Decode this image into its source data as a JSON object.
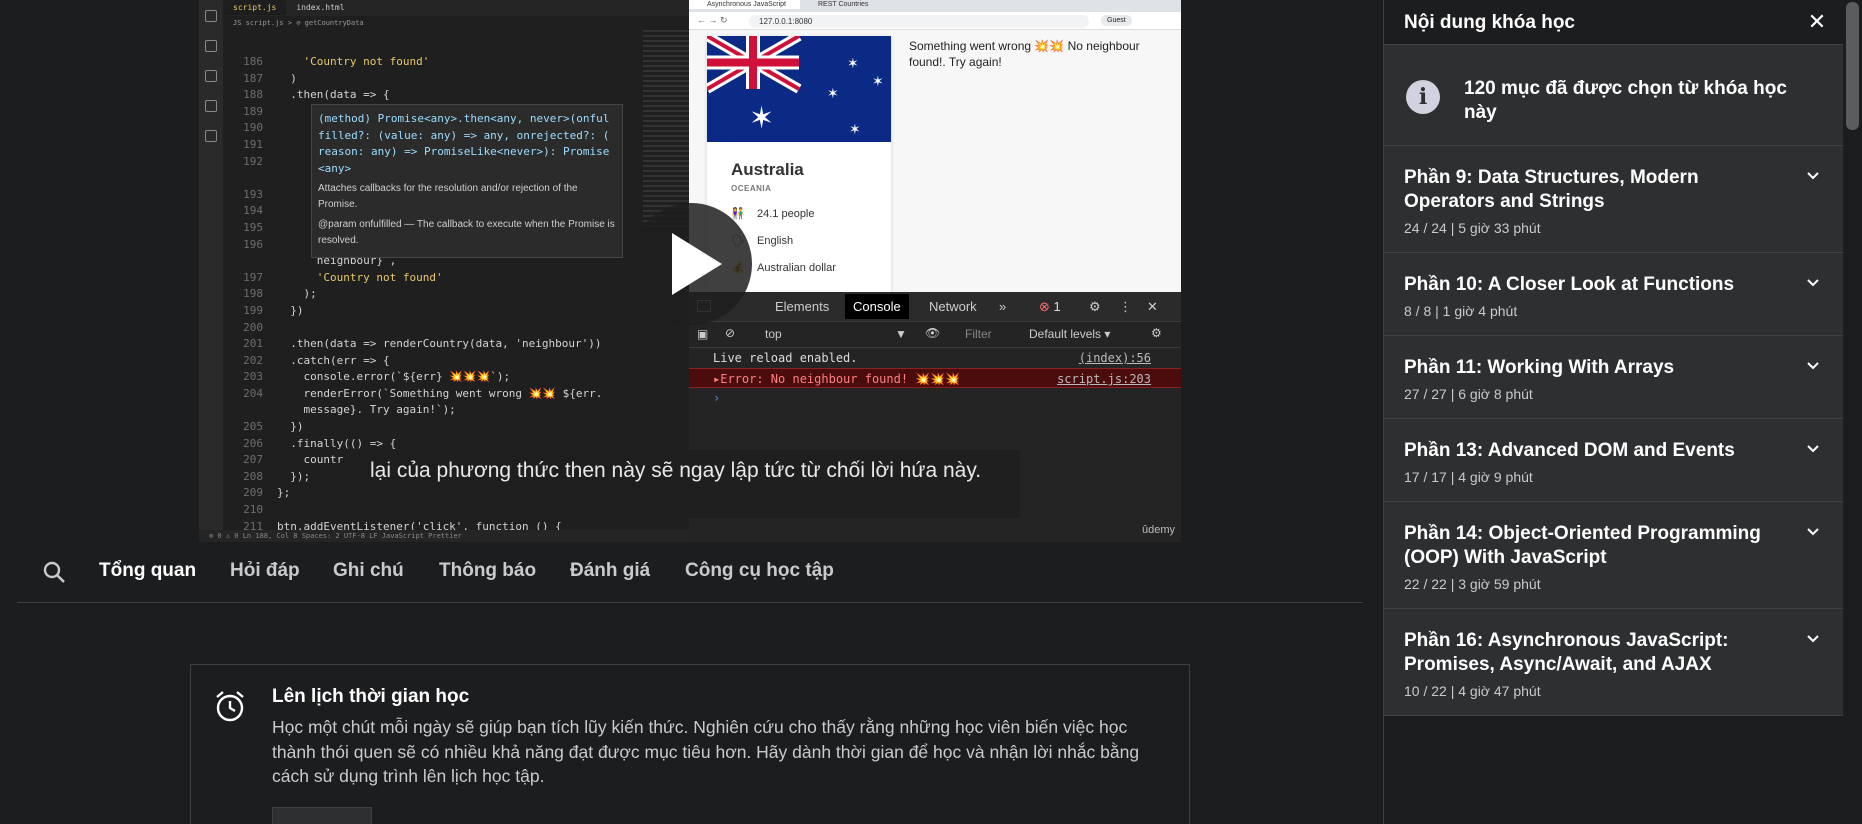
{
  "video": {
    "vscode": {
      "tabs": [
        "script.js",
        "index.html"
      ],
      "breadcrumb": "JS script.js > ⊘ getCountryData",
      "code_lines": [
        {
          "n": "186",
          "t": "    'Country not found'"
        },
        {
          "n": "187",
          "t": "  )"
        },
        {
          "n": "188",
          "t": "  .then(data => {"
        },
        {
          "n": "189",
          "t": ""
        },
        {
          "n": "190",
          "t": ""
        },
        {
          "n": "191",
          "t": ""
        },
        {
          "n": "192",
          "t": ""
        },
        {
          "n": "",
          "t": ""
        },
        {
          "n": "193",
          "t": ""
        },
        {
          "n": "194",
          "t": ""
        },
        {
          "n": "195",
          "t": ""
        },
        {
          "n": "196",
          "t": ""
        },
        {
          "n": "",
          "t": "      neighbour} ,"
        },
        {
          "n": "197",
          "t": "      'Country not found'"
        },
        {
          "n": "198",
          "t": "    );"
        },
        {
          "n": "199",
          "t": "  })"
        },
        {
          "n": "200",
          "t": ""
        },
        {
          "n": "201",
          "t": "  .then(data => renderCountry(data, 'neighbour'))"
        },
        {
          "n": "202",
          "t": "  .catch(err => {"
        },
        {
          "n": "203",
          "t": "    console.error(`${err} 💥💥💥`);"
        },
        {
          "n": "204",
          "t": "    renderError(`Something went wrong 💥💥 ${err."
        },
        {
          "n": "",
          "t": "    message}. Try again!`);"
        },
        {
          "n": "205",
          "t": "  })"
        },
        {
          "n": "206",
          "t": "  .finally(() => {"
        },
        {
          "n": "207",
          "t": "    countr"
        },
        {
          "n": "208",
          "t": "  });"
        },
        {
          "n": "209",
          "t": "};"
        },
        {
          "n": "210",
          "t": ""
        },
        {
          "n": "211",
          "t": "btn.addEventListener('click', function () {"
        }
      ],
      "tooltip_sig": "(method) Promise<any>.then<any, never>(onful\nfilled?: (value: any) => any, onrejected?: (\nreason: any) => PromiseLike<never>): Promise\n<any>",
      "tooltip_doc1": "Attaches callbacks for the resolution and/or rejection of the Promise.",
      "tooltip_doc2": "@param onfulfilled — The callback to execute when the Promise is resolved.",
      "status": "⊗ 0 ⚠ 0        Ln 188, Col 8   Spaces: 2   UTF-8   LF   JavaScript   Prettier"
    },
    "browser": {
      "tabs": [
        "Asynchronous JavaScript",
        "REST Countries"
      ],
      "url": "127.0.0.1:8080",
      "guest": "Guest",
      "country": "Australia",
      "region": "OCEANIA",
      "population": "24.1 people",
      "language": "English",
      "currency": "Australian dollar",
      "error_msg": "Something went wrong 💥💥 No neighbour found!. Try again!",
      "devtools_tabs": [
        "Elements",
        "Console",
        "Network",
        "»"
      ],
      "error_count": "1",
      "context": "top",
      "filter_placeholder": "Filter",
      "levels": "Default levels ▾",
      "console": [
        {
          "text": "Live reload enabled.",
          "src": "(index):56",
          "type": "log"
        },
        {
          "text": "▸Error: No neighbour found! 💥💥💥",
          "src": "script.js:203",
          "type": "error"
        }
      ]
    },
    "caption": "lại của phương thức then này sẽ ngay lập tức từ chối lời hứa này.",
    "watermark": "ûdemy"
  },
  "tabs": {
    "items": [
      "Tổng quan",
      "Hỏi đáp",
      "Ghi chú",
      "Thông báo",
      "Đánh giá",
      "Công cụ học tập"
    ],
    "active": 0
  },
  "schedule": {
    "title": "Lên lịch thời gian học",
    "body": "Học một chút mỗi ngày sẽ giúp bạn tích lũy kiến thức. Nghiên cứu cho thấy rằng những học viên biến việc học thành thói quen sẽ có nhiều khả năng đạt được mục tiêu hơn. Hãy dành thời gian để học và nhận lời nhắc bằng cách sử dụng trình lên lịch học tập."
  },
  "sidebar": {
    "title": "Nội dung khóa học",
    "info": "120 mục đã được chọn từ khóa học này",
    "sections": [
      {
        "title": "Phần 9: Data Structures, Modern Operators and Strings",
        "meta": "24 / 24 | 5 giờ 33 phút"
      },
      {
        "title": "Phần 10: A Closer Look at Functions",
        "meta": "8 / 8 | 1 giờ 4 phút"
      },
      {
        "title": "Phần 11: Working With Arrays",
        "meta": "27 / 27 | 6 giờ 8 phút"
      },
      {
        "title": "Phần 13: Advanced DOM and Events",
        "meta": "17 / 17 | 4 giờ 9 phút"
      },
      {
        "title": "Phần 14: Object-Oriented Programming (OOP) With JavaScript",
        "meta": "22 / 22 | 3 giờ 59 phút"
      },
      {
        "title": "Phần 16: Asynchronous JavaScript: Promises, Async/Await, and AJAX",
        "meta": "10 / 22 | 4 giờ 47 phút"
      }
    ]
  }
}
